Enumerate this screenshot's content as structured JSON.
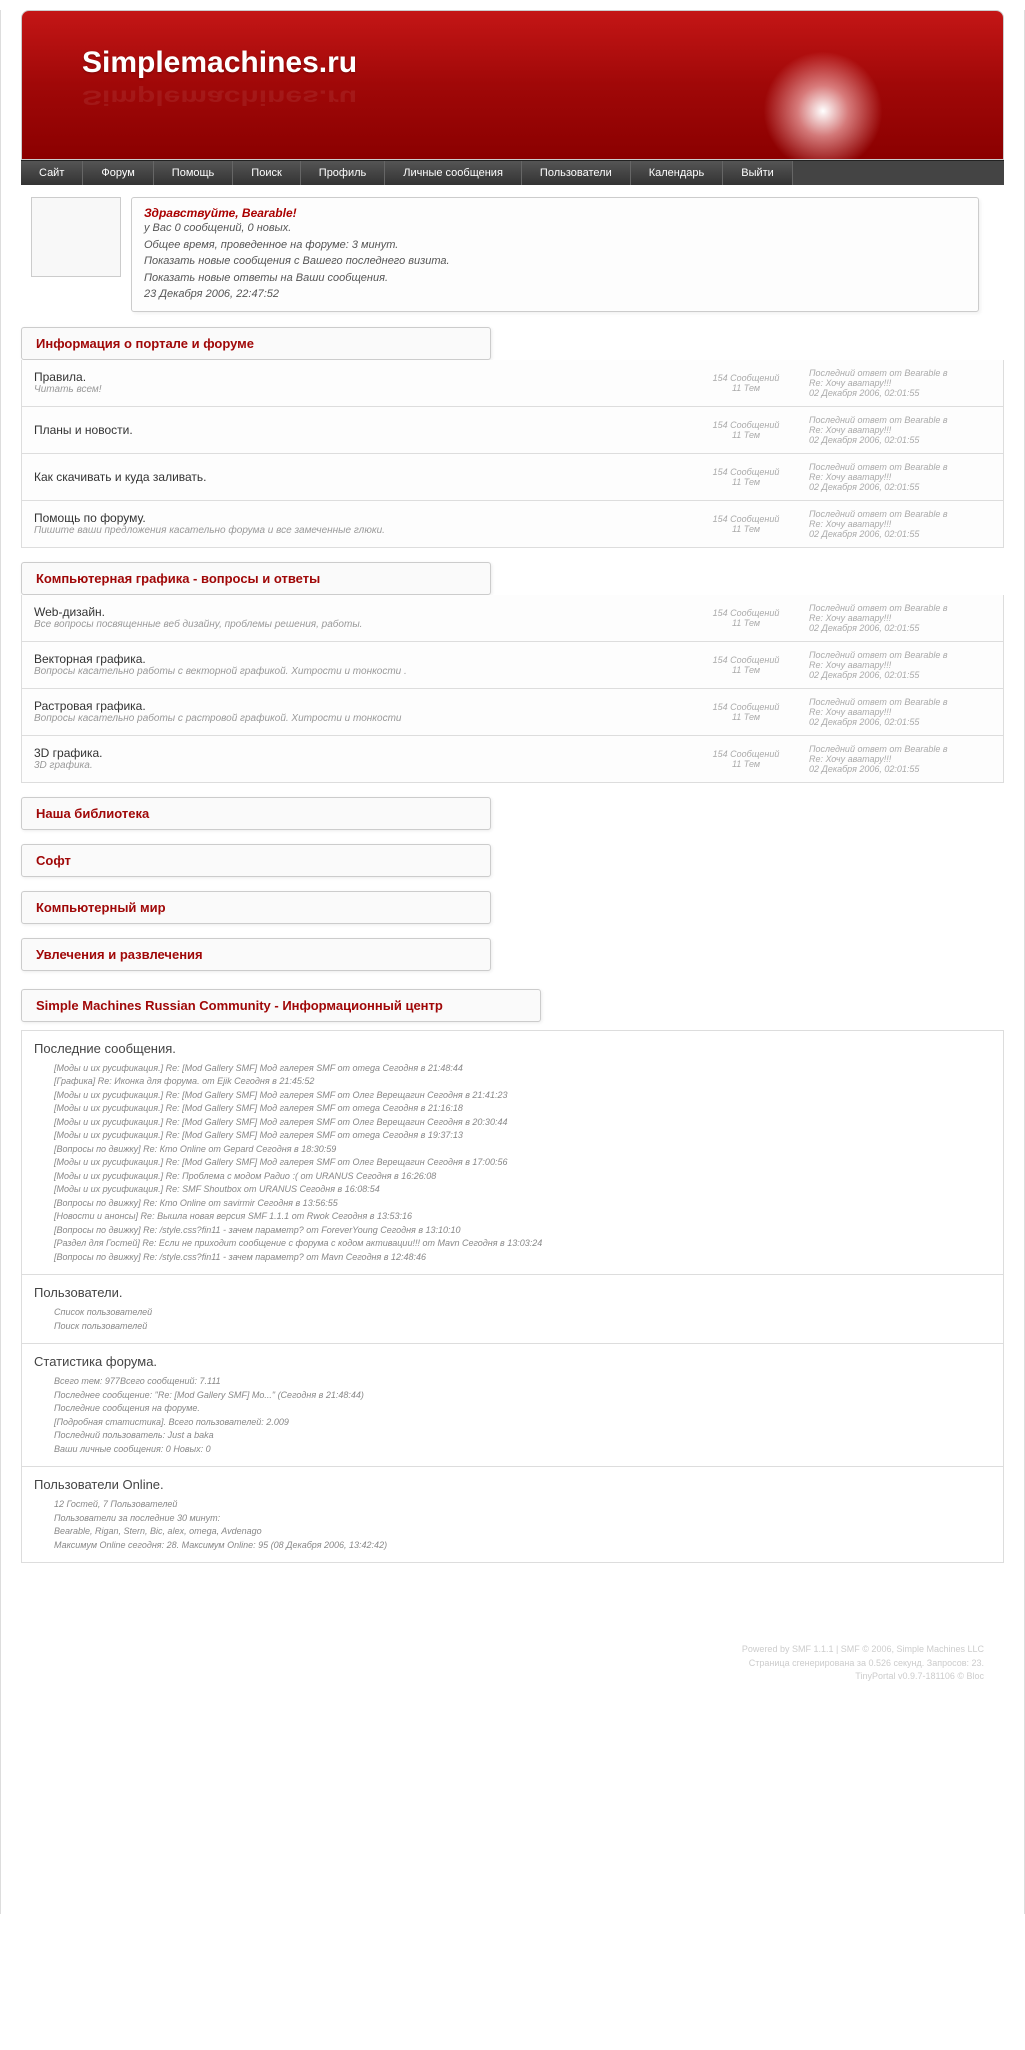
{
  "site": {
    "title": "Simplemachines.ru"
  },
  "nav": [
    "Сайт",
    "Форум",
    "Помощь",
    "Поиск",
    "Профиль",
    "Личные сообщения",
    "Пользователи",
    "Календарь",
    "Выйти"
  ],
  "welcome": {
    "greet": "Здравствуйте, Bearable!",
    "l1": "у Вас 0 сообщений, 0 новых.",
    "l2": "Общее время, проведенное на форуме: 3 минут.",
    "l3": "Показать новые сообщения с Вашего последнего визита.",
    "l4": "Показать новые ответы на Ваши сообщения.",
    "l5": "23 Декабря 2006, 22:47:52"
  },
  "lastpost": {
    "l1": "Последний ответ от Bearable в",
    "l2": "Re: Хочу аватару!!!",
    "l3": "02 Декабря 2006, 02:01:55"
  },
  "stats": {
    "posts": "154 Сообщений",
    "topics": "11 Тем"
  },
  "cats": [
    {
      "title": "Информация о портале и форуме",
      "boards": [
        {
          "t": "Правила.",
          "d": "Читать всем!"
        },
        {
          "t": "Планы и новости.",
          "d": ""
        },
        {
          "t": "Как скачивать и куда заливать.",
          "d": ""
        },
        {
          "t": "Помощь по форуму.",
          "d": "Пишите ваши предложения касательно форума и все замеченные глюки."
        }
      ]
    },
    {
      "title": "Компьютерная графика - вопросы и ответы",
      "boards": [
        {
          "t": "Web-дизайн.",
          "d": "Все вопросы посвященные веб дизайну, проблемы решения, работы."
        },
        {
          "t": "Векторная графика.",
          "d": "Вопросы касательно работы с векторной графикой. Хитрости и тонкости ."
        },
        {
          "t": "Растровая графика.",
          "d": "Вопросы касательно работы с растровой графикой. Хитрости и тонкости"
        },
        {
          "t": "3D графика.",
          "d": "3D графика."
        }
      ]
    },
    {
      "title": "Наша библиотека",
      "boards": []
    },
    {
      "title": "Софт",
      "boards": []
    },
    {
      "title": "Компьютерный мир",
      "boards": []
    },
    {
      "title": "Увлечения и развлечения",
      "boards": []
    }
  ],
  "infocenter_title": "Simple Machines Russian Community - Информационный центр",
  "recent": {
    "title": "Последние сообщения.",
    "items": [
      "[Моды и их русификация.] Re: [Mod Gallery SMF] Мод галерея SMF от omega Сегодня в 21:48:44",
      "[Графика] Re: Иконка для форума. от Ejik Сегодня в 21:45:52",
      "[Моды и их русификация.] Re: [Mod Gallery SMF] Мод галерея SMF от Олег Верещагин Сегодня в 21:41:23",
      "[Моды и их русификация.] Re: [Mod Gallery SMF] Мод галерея SMF от omega Сегодня в 21:16:18",
      "[Моды и их русификация.] Re: [Mod Gallery SMF] Мод галерея SMF от Олег Верещагин Сегодня в 20:30:44",
      "[Моды и их русификация.] Re: [Mod Gallery SMF] Мод галерея SMF от omega Сегодня в 19:37:13",
      "[Вопросы по движку] Re: Кто Online от Gepard Сегодня в 18:30:59",
      "[Моды и их русификация.] Re: [Mod Gallery SMF] Мод галерея SMF от Олег Верещагин Сегодня в 17:00:56",
      "[Моды и их русификация.] Re: Проблема с модом Радио :( от URANUS Сегодня в 16:26:08",
      "[Моды и их русификация.] Re: SMF Shoutbox от URANUS Сегодня в 16:08:54",
      "[Вопросы по движку] Re: Кто Online от savirmir Сегодня в 13:56:55",
      "[Новости и анонсы] Re: Вышла новая версия SMF 1.1.1 от Rwok Сегодня в 13:53:16",
      "[Вопросы по движку] Re: /style.css?fin11 - зачем параметр? от ForeverYoung Сегодня в 13:10:10",
      "[Раздел для Гостей] Re: Если не приходит сообщение с форума с кодом активации!!! от Mavn Сегодня в 13:03:24",
      "[Вопросы по движку] Re: /style.css?fin11 - зачем параметр? от Mavn Сегодня в 12:48:46"
    ]
  },
  "users": {
    "title": "Пользователи.",
    "l1": "Список пользователей",
    "l2": "Поиск пользователей"
  },
  "fstats": {
    "title": "Статистика форума.",
    "l1": "Всего тем: 977Всего сообщений: 7.111",
    "l2": "Последнее сообщение: \"Re: [Mod Gallery SMF] Мо...\" (Сегодня в 21:48:44)",
    "l3": "Последние сообщения на форуме.",
    "l4": "[Подробная статистика]. Всего пользователей: 2.009",
    "l5": "Последний пользователь: Just a baka",
    "l6": "Ваши личные сообщения: 0 Новых: 0"
  },
  "online": {
    "title": "Пользователи Online.",
    "l1": "12 Гостей, 7 Пользователей",
    "l2": "Пользователи за последние 30 минут:",
    "l3": "Bearable, Rigan, Stern, Bic, alex, omega, Avdenago",
    "l4": "Максимум Online сегодня: 28. Максимум Online: 95 (08 Декабря 2006, 13:42:42)"
  },
  "footer": {
    "l1": "Powered by SMF 1.1.1 | SMF © 2006, Simple Machines LLC",
    "l2": "Страница сгенерирована за 0.526 секунд. Запросов: 23.",
    "l3": "TinyPortal v0.9.7-181106 © Bloc"
  }
}
